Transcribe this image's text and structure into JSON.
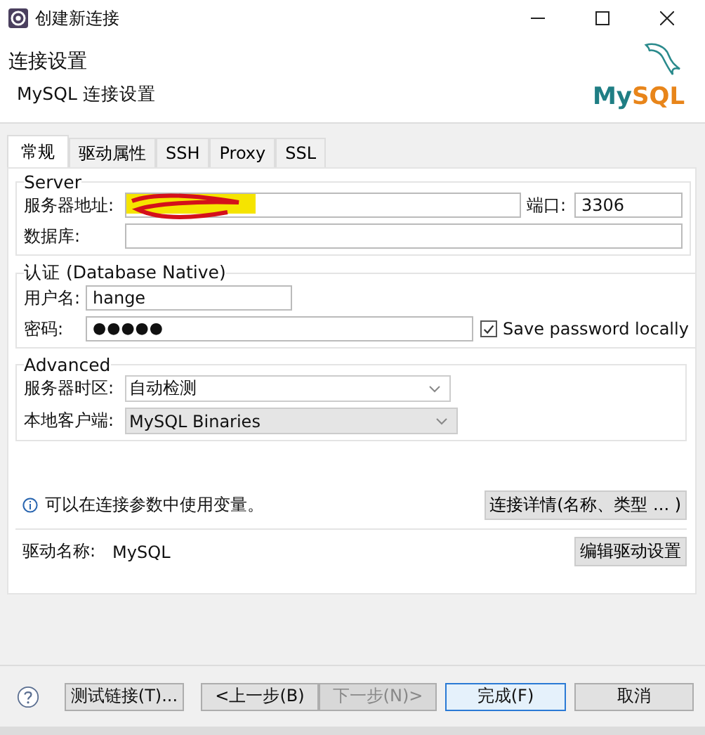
{
  "window": {
    "title": "创建新连接"
  },
  "header": {
    "title": "连接设置",
    "subtitle": "MySQL 连接设置",
    "logo": {
      "primary": "My",
      "accent": "SQL"
    }
  },
  "tabs": [
    {
      "label": "常规",
      "selected": true
    },
    {
      "label": "驱动属性",
      "selected": false
    },
    {
      "label": "SSH",
      "selected": false
    },
    {
      "label": "Proxy",
      "selected": false
    },
    {
      "label": "SSL",
      "selected": false
    }
  ],
  "server": {
    "title": "Server",
    "host": {
      "label": "服务器地址:",
      "redacted": true
    },
    "port": {
      "label": "端口:",
      "value": "3306"
    },
    "database": {
      "label": "数据库:"
    }
  },
  "auth": {
    "title": "认证 (Database Native)",
    "username": {
      "label": "用户名:",
      "value": "hange"
    },
    "password": {
      "label": "密码:",
      "value": "●●●●●"
    },
    "save_password": {
      "label": "Save password locally",
      "checked": true
    }
  },
  "advanced": {
    "title": "Advanced",
    "timezone": {
      "label": "服务器时区:",
      "value": "自动检测"
    },
    "client": {
      "label": "本地客户端:",
      "value": "MySQL Binaries"
    }
  },
  "info": {
    "text": "可以在连接参数中使用变量。",
    "button": "连接详情(名称、类型 ... )"
  },
  "driver": {
    "label": "驱动名称:",
    "value": "MySQL",
    "button": "编辑驱动设置"
  },
  "footer": {
    "buttons": [
      {
        "label": "测试链接(T)...",
        "disabled": false,
        "default": false
      },
      {
        "label": "<上一步(B)",
        "disabled": false,
        "default": false
      },
      {
        "label": "下一步(N)>",
        "disabled": true,
        "default": false
      },
      {
        "label": "完成(F)",
        "disabled": false,
        "default": true
      },
      {
        "label": "取消",
        "disabled": false,
        "default": false
      }
    ]
  }
}
